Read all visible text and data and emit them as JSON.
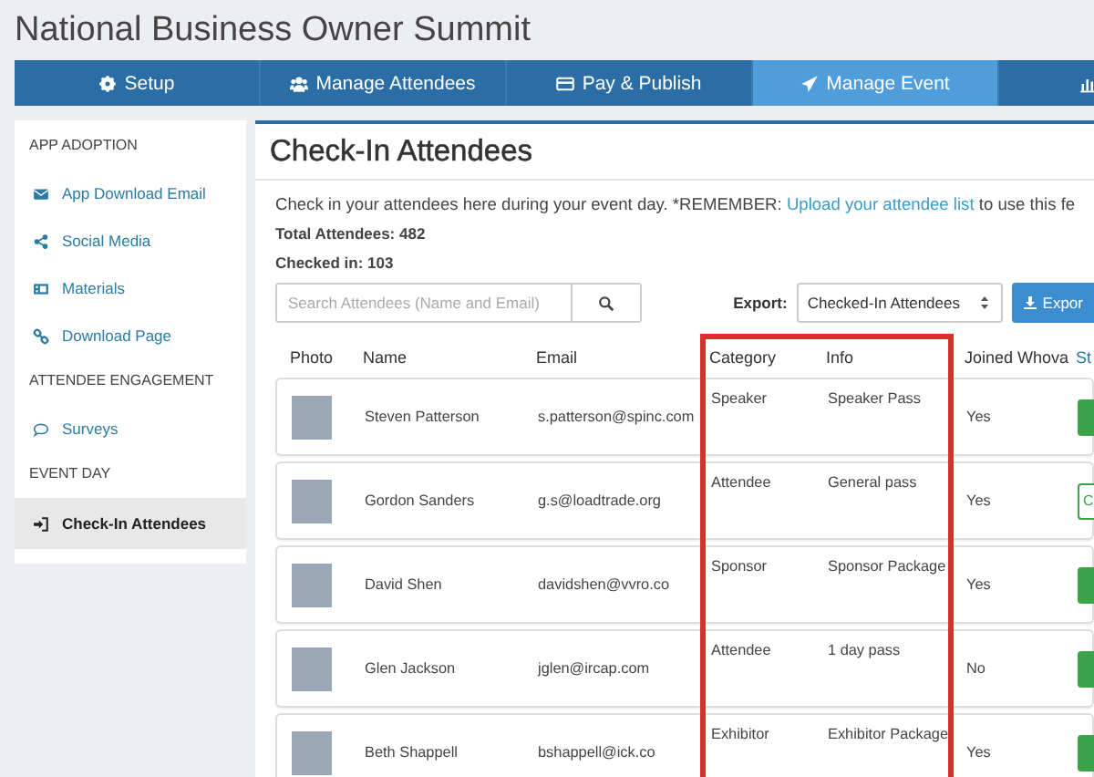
{
  "app_title": "National Business Owner Summit",
  "tabs": [
    {
      "label": "Setup",
      "selected": false
    },
    {
      "label": "Manage Attendees",
      "selected": false
    },
    {
      "label": "Pay & Publish",
      "selected": false
    },
    {
      "label": "Manage Event",
      "selected": true
    },
    {
      "selected": false
    }
  ],
  "sidebar": {
    "items": [
      {
        "kind": "header",
        "label": "APP ADOPTION"
      },
      {
        "kind": "link",
        "label": "App Download Email",
        "selected": false
      },
      {
        "kind": "link",
        "label": "Social Media",
        "selected": false
      },
      {
        "kind": "link",
        "label": "Materials",
        "selected": false
      },
      {
        "kind": "link",
        "label": "Download Page",
        "selected": false
      },
      {
        "kind": "header",
        "label": "ATTENDEE ENGAGEMENT"
      },
      {
        "kind": "link",
        "label": "Surveys",
        "selected": false
      },
      {
        "kind": "header",
        "label": "EVENT DAY"
      },
      {
        "kind": "link",
        "label": "Check-In Attendees",
        "selected": true
      }
    ]
  },
  "page": {
    "heading": "Check-In Attendees",
    "description": {
      "text_before": "Check in your attendees here during your event day. *REMEMBER: ",
      "link": "Upload your attendee list",
      "text_after": " to use this fe"
    },
    "total_attendees": "Total Attendees: 482",
    "checked_in": "Checked in: 103",
    "search": {
      "placeholder": "Search Attendees (Name and Email)"
    },
    "export": {
      "label": "Export:",
      "value": "Checked-In Attendees",
      "button": "Expor"
    }
  },
  "table": {
    "columns": [
      {
        "label": "Photo",
        "highlighted": false
      },
      {
        "label": "Name",
        "highlighted": false
      },
      {
        "label": "Email",
        "highlighted": false
      },
      {
        "label": "Category",
        "highlighted": true
      },
      {
        "label": "Info",
        "highlighted": true
      },
      {
        "label": "Joined Whova",
        "highlighted": false
      },
      {
        "label": "St",
        "highlighted": false
      }
    ],
    "rows": [
      {
        "name": "Steven Patterson",
        "email": "s.patterson@spinc.com",
        "category": "Speaker",
        "info": "Speaker Pass",
        "joined": "Yes",
        "status": {
          "kind": "filled"
        }
      },
      {
        "name": "Gordon Sanders",
        "email": "g.s@loadtrade.org",
        "category": "Attendee",
        "info": "General pass",
        "joined": "Yes",
        "status": {
          "kind": "outline",
          "label": "C"
        }
      },
      {
        "name": "David Shen",
        "email": "davidshen@vvro.co",
        "category": "Sponsor",
        "info": "Sponsor Package",
        "joined": "Yes",
        "status": {
          "kind": "filled"
        }
      },
      {
        "name": "Glen Jackson",
        "email": "jglen@ircap.com",
        "category": "Attendee",
        "info": "1 day pass",
        "joined": "No",
        "status": {
          "kind": "filled"
        }
      },
      {
        "name": "Beth Shappell",
        "email": "bshappell@ick.co",
        "category": "Exhibitor",
        "info": "Exhibitor Package",
        "joined": "Yes",
        "status": {
          "kind": "filled"
        }
      }
    ]
  }
}
